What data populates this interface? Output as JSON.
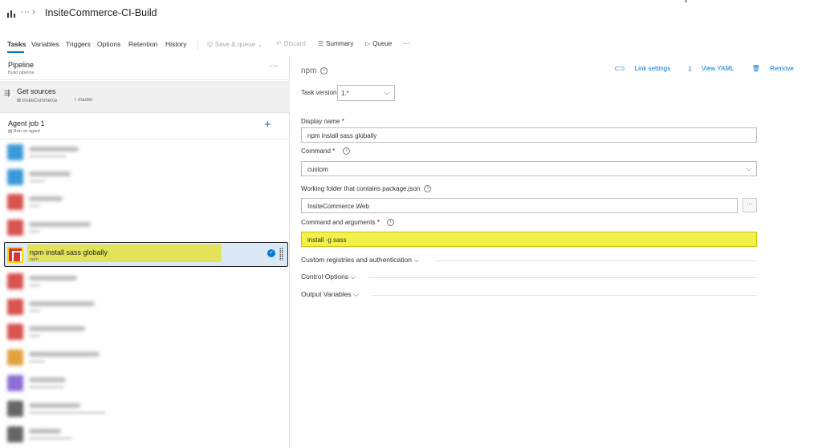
{
  "header": {
    "ellipsis": "···",
    "separator": "›",
    "title": "InsiteCommerce-CI-Build"
  },
  "tabs": [
    "Tasks",
    "Variables",
    "Triggers",
    "Options",
    "Retention",
    "History"
  ],
  "toolbar": {
    "save_queue": "Save & queue",
    "discard": "Discard",
    "summary": "Summary",
    "queue": "Queue",
    "more": "···"
  },
  "pipeline": {
    "title": "Pipeline",
    "subtitle": "Build pipeline",
    "more": "···"
  },
  "get_sources": {
    "title": "Get sources",
    "repo": "InsiteCommerce",
    "branch": "master"
  },
  "agent_job": {
    "title": "Agent job 1",
    "subtitle": "Run on agent",
    "add": "+"
  },
  "selected_task": {
    "title": "npm install sass globally",
    "subtitle": "npm"
  },
  "details": {
    "heading": "npm",
    "link_settings": "Link settings",
    "view_yaml": "View YAML",
    "remove": "Remove",
    "task_version_label": "Task version",
    "task_version_value": "1.*",
    "display_name_label": "Display name",
    "display_name_value": "npm install sass globally",
    "command_label": "Command",
    "command_value": "custom",
    "working_folder_label": "Working folder that contains package.json",
    "working_folder_value": "InsiteCommerce.Web",
    "command_args_label": "Command and arguments",
    "command_args_value": "install -g sass",
    "section_custom_registries": "Custom registries and authentication",
    "section_control_options": "Control Options",
    "section_output_variables": "Output Variables"
  },
  "colors": {
    "accent": "#0078d4",
    "highlight": "#f1f14a",
    "npm_red": "#cb3837"
  }
}
